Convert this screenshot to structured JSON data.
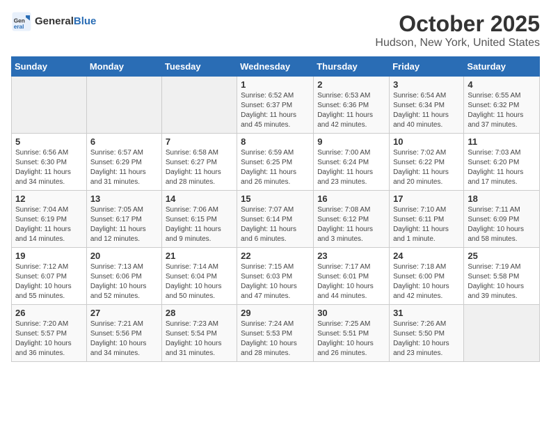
{
  "header": {
    "logo_general": "General",
    "logo_blue": "Blue",
    "title": "October 2025",
    "subtitle": "Hudson, New York, United States"
  },
  "days_of_week": [
    "Sunday",
    "Monday",
    "Tuesday",
    "Wednesday",
    "Thursday",
    "Friday",
    "Saturday"
  ],
  "weeks": [
    [
      {
        "day": "",
        "info": ""
      },
      {
        "day": "",
        "info": ""
      },
      {
        "day": "",
        "info": ""
      },
      {
        "day": "1",
        "info": "Sunrise: 6:52 AM\nSunset: 6:37 PM\nDaylight: 11 hours and 45 minutes."
      },
      {
        "day": "2",
        "info": "Sunrise: 6:53 AM\nSunset: 6:36 PM\nDaylight: 11 hours and 42 minutes."
      },
      {
        "day": "3",
        "info": "Sunrise: 6:54 AM\nSunset: 6:34 PM\nDaylight: 11 hours and 40 minutes."
      },
      {
        "day": "4",
        "info": "Sunrise: 6:55 AM\nSunset: 6:32 PM\nDaylight: 11 hours and 37 minutes."
      }
    ],
    [
      {
        "day": "5",
        "info": "Sunrise: 6:56 AM\nSunset: 6:30 PM\nDaylight: 11 hours and 34 minutes."
      },
      {
        "day": "6",
        "info": "Sunrise: 6:57 AM\nSunset: 6:29 PM\nDaylight: 11 hours and 31 minutes."
      },
      {
        "day": "7",
        "info": "Sunrise: 6:58 AM\nSunset: 6:27 PM\nDaylight: 11 hours and 28 minutes."
      },
      {
        "day": "8",
        "info": "Sunrise: 6:59 AM\nSunset: 6:25 PM\nDaylight: 11 hours and 26 minutes."
      },
      {
        "day": "9",
        "info": "Sunrise: 7:00 AM\nSunset: 6:24 PM\nDaylight: 11 hours and 23 minutes."
      },
      {
        "day": "10",
        "info": "Sunrise: 7:02 AM\nSunset: 6:22 PM\nDaylight: 11 hours and 20 minutes."
      },
      {
        "day": "11",
        "info": "Sunrise: 7:03 AM\nSunset: 6:20 PM\nDaylight: 11 hours and 17 minutes."
      }
    ],
    [
      {
        "day": "12",
        "info": "Sunrise: 7:04 AM\nSunset: 6:19 PM\nDaylight: 11 hours and 14 minutes."
      },
      {
        "day": "13",
        "info": "Sunrise: 7:05 AM\nSunset: 6:17 PM\nDaylight: 11 hours and 12 minutes."
      },
      {
        "day": "14",
        "info": "Sunrise: 7:06 AM\nSunset: 6:15 PM\nDaylight: 11 hours and 9 minutes."
      },
      {
        "day": "15",
        "info": "Sunrise: 7:07 AM\nSunset: 6:14 PM\nDaylight: 11 hours and 6 minutes."
      },
      {
        "day": "16",
        "info": "Sunrise: 7:08 AM\nSunset: 6:12 PM\nDaylight: 11 hours and 3 minutes."
      },
      {
        "day": "17",
        "info": "Sunrise: 7:10 AM\nSunset: 6:11 PM\nDaylight: 11 hours and 1 minute."
      },
      {
        "day": "18",
        "info": "Sunrise: 7:11 AM\nSunset: 6:09 PM\nDaylight: 10 hours and 58 minutes."
      }
    ],
    [
      {
        "day": "19",
        "info": "Sunrise: 7:12 AM\nSunset: 6:07 PM\nDaylight: 10 hours and 55 minutes."
      },
      {
        "day": "20",
        "info": "Sunrise: 7:13 AM\nSunset: 6:06 PM\nDaylight: 10 hours and 52 minutes."
      },
      {
        "day": "21",
        "info": "Sunrise: 7:14 AM\nSunset: 6:04 PM\nDaylight: 10 hours and 50 minutes."
      },
      {
        "day": "22",
        "info": "Sunrise: 7:15 AM\nSunset: 6:03 PM\nDaylight: 10 hours and 47 minutes."
      },
      {
        "day": "23",
        "info": "Sunrise: 7:17 AM\nSunset: 6:01 PM\nDaylight: 10 hours and 44 minutes."
      },
      {
        "day": "24",
        "info": "Sunrise: 7:18 AM\nSunset: 6:00 PM\nDaylight: 10 hours and 42 minutes."
      },
      {
        "day": "25",
        "info": "Sunrise: 7:19 AM\nSunset: 5:58 PM\nDaylight: 10 hours and 39 minutes."
      }
    ],
    [
      {
        "day": "26",
        "info": "Sunrise: 7:20 AM\nSunset: 5:57 PM\nDaylight: 10 hours and 36 minutes."
      },
      {
        "day": "27",
        "info": "Sunrise: 7:21 AM\nSunset: 5:56 PM\nDaylight: 10 hours and 34 minutes."
      },
      {
        "day": "28",
        "info": "Sunrise: 7:23 AM\nSunset: 5:54 PM\nDaylight: 10 hours and 31 minutes."
      },
      {
        "day": "29",
        "info": "Sunrise: 7:24 AM\nSunset: 5:53 PM\nDaylight: 10 hours and 28 minutes."
      },
      {
        "day": "30",
        "info": "Sunrise: 7:25 AM\nSunset: 5:51 PM\nDaylight: 10 hours and 26 minutes."
      },
      {
        "day": "31",
        "info": "Sunrise: 7:26 AM\nSunset: 5:50 PM\nDaylight: 10 hours and 23 minutes."
      },
      {
        "day": "",
        "info": ""
      }
    ]
  ]
}
